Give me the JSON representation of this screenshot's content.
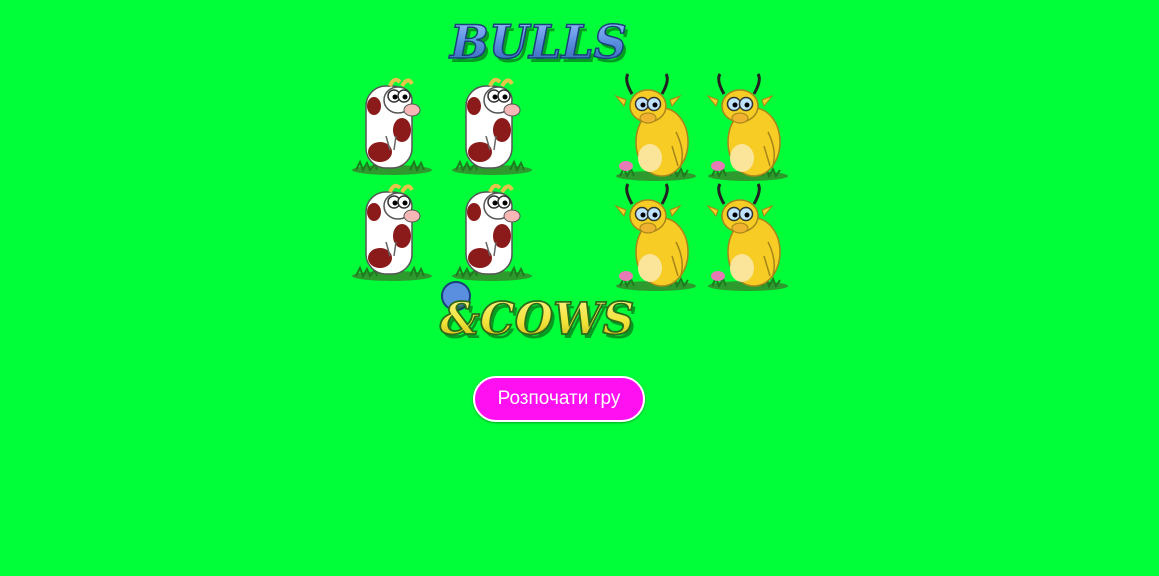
{
  "colors": {
    "background": "#00ff39",
    "button": "#ff10f0",
    "button_text": "#ffffff",
    "logo_bulls_fill": "#5a8fe0",
    "logo_cows_fill": "#f2e23a"
  },
  "logo": {
    "top_text": "BULLS",
    "bottom_text": "&COWS"
  },
  "animals": {
    "cows": [
      {
        "kind": "cow",
        "icon": "cow-icon"
      },
      {
        "kind": "cow",
        "icon": "cow-icon"
      },
      {
        "kind": "cow",
        "icon": "cow-icon"
      },
      {
        "kind": "cow",
        "icon": "cow-icon"
      }
    ],
    "bulls": [
      {
        "kind": "bull",
        "icon": "bull-icon"
      },
      {
        "kind": "bull",
        "icon": "bull-icon"
      },
      {
        "kind": "bull",
        "icon": "bull-icon"
      },
      {
        "kind": "bull",
        "icon": "bull-icon"
      }
    ]
  },
  "start_button": {
    "label": "Розпочати гру"
  }
}
